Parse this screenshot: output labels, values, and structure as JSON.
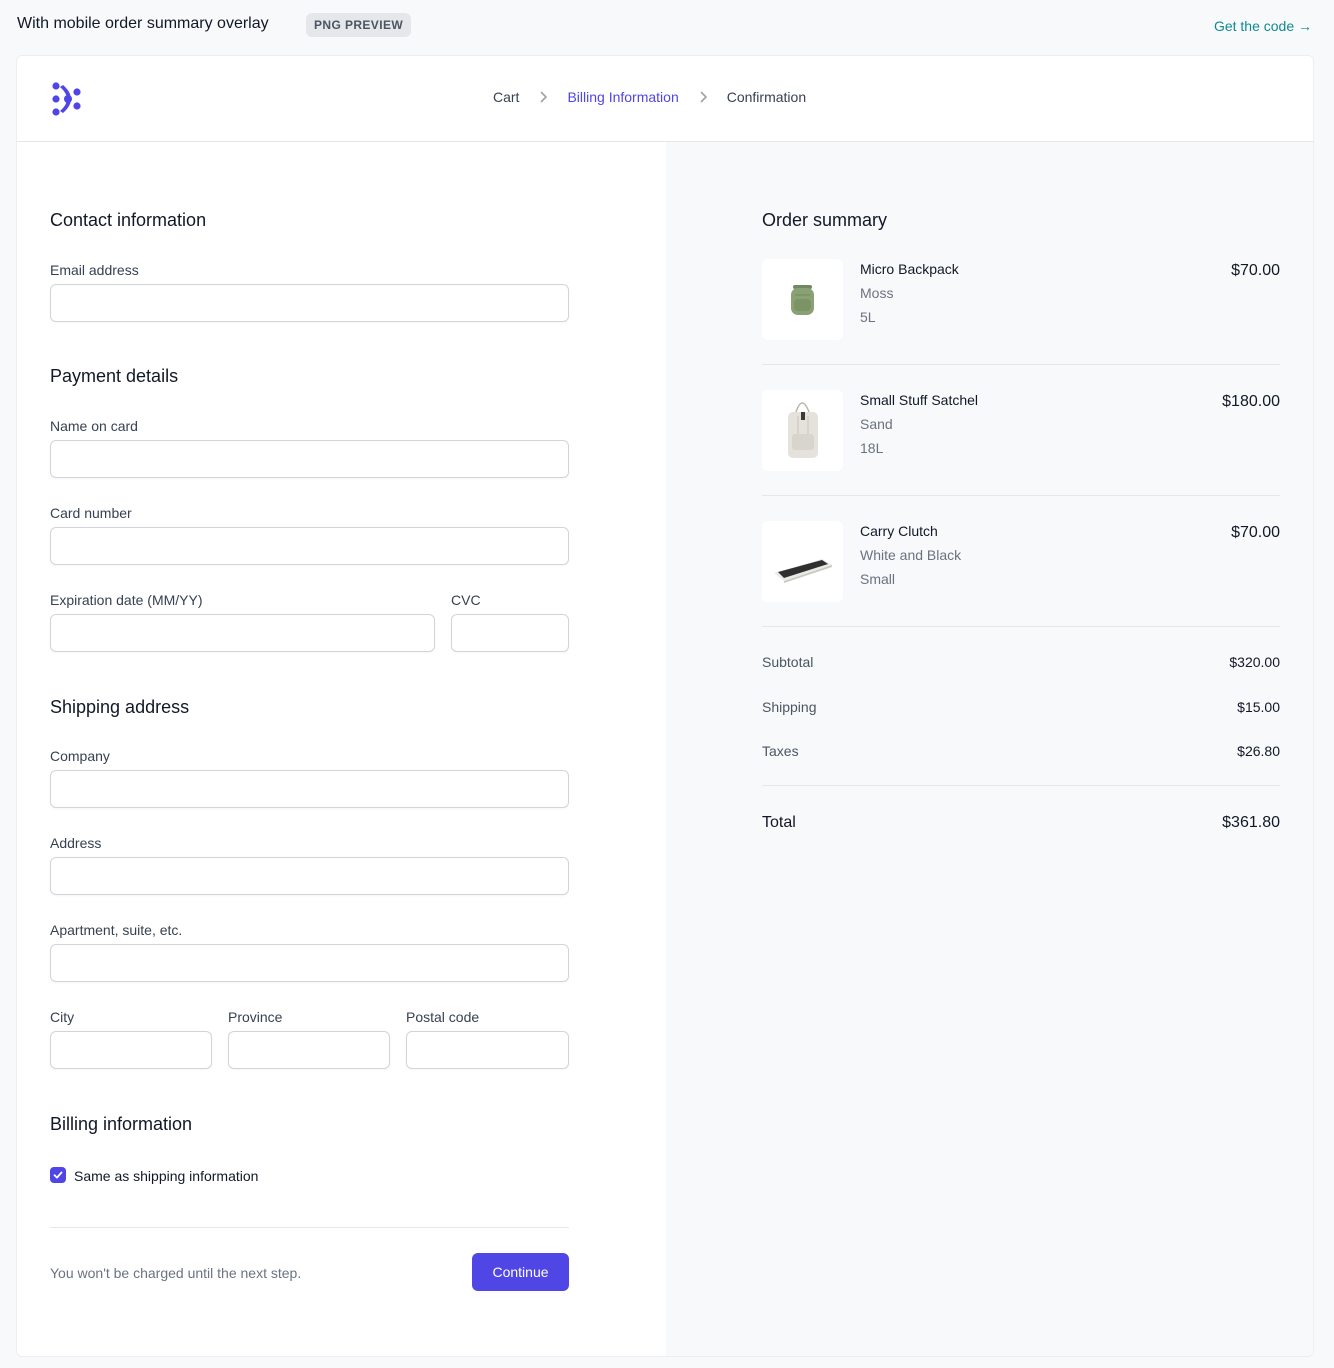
{
  "preview_bar": {
    "title": "With mobile order summary overlay",
    "badge": "PNG PREVIEW",
    "get_code": "Get the code →"
  },
  "breadcrumb": {
    "steps": [
      "Cart",
      "Billing Information",
      "Confirmation"
    ],
    "active_index": 1
  },
  "form": {
    "contact": {
      "title": "Contact information",
      "email_label": "Email address",
      "email_value": ""
    },
    "payment": {
      "title": "Payment details",
      "name_label": "Name on card",
      "card_label": "Card number",
      "expiry_label": "Expiration date (MM/YY)",
      "cvc_label": "CVC"
    },
    "shipping": {
      "title": "Shipping address",
      "company_label": "Company",
      "address_label": "Address",
      "apartment_label": "Apartment, suite, etc.",
      "city_label": "City",
      "province_label": "Province",
      "postal_label": "Postal code"
    },
    "billing": {
      "title": "Billing information",
      "same_as_shipping_label": "Same as shipping information",
      "same_as_shipping_checked": true
    },
    "footer_note": "You won't be charged until the next step.",
    "continue_label": "Continue"
  },
  "order_summary": {
    "title": "Order summary",
    "items": [
      {
        "name": "Micro Backpack",
        "color": "Moss",
        "size": "5L",
        "price": "$70.00",
        "image": "backpack-image"
      },
      {
        "name": "Small Stuff Satchel",
        "color": "Sand",
        "size": "18L",
        "price": "$180.00",
        "image": "satchel-image"
      },
      {
        "name": "Carry Clutch",
        "color": "White and Black",
        "size": "Small",
        "price": "$70.00",
        "image": "clutch-image"
      }
    ],
    "subtotal_label": "Subtotal",
    "subtotal": "$320.00",
    "shipping_label": "Shipping",
    "shipping": "$15.00",
    "taxes_label": "Taxes",
    "taxes": "$26.80",
    "total_label": "Total",
    "total": "$361.80"
  },
  "colors": {
    "accent": "#4f46e5",
    "link": "#0e8a94",
    "summary_bg": "#f8f9fb"
  }
}
